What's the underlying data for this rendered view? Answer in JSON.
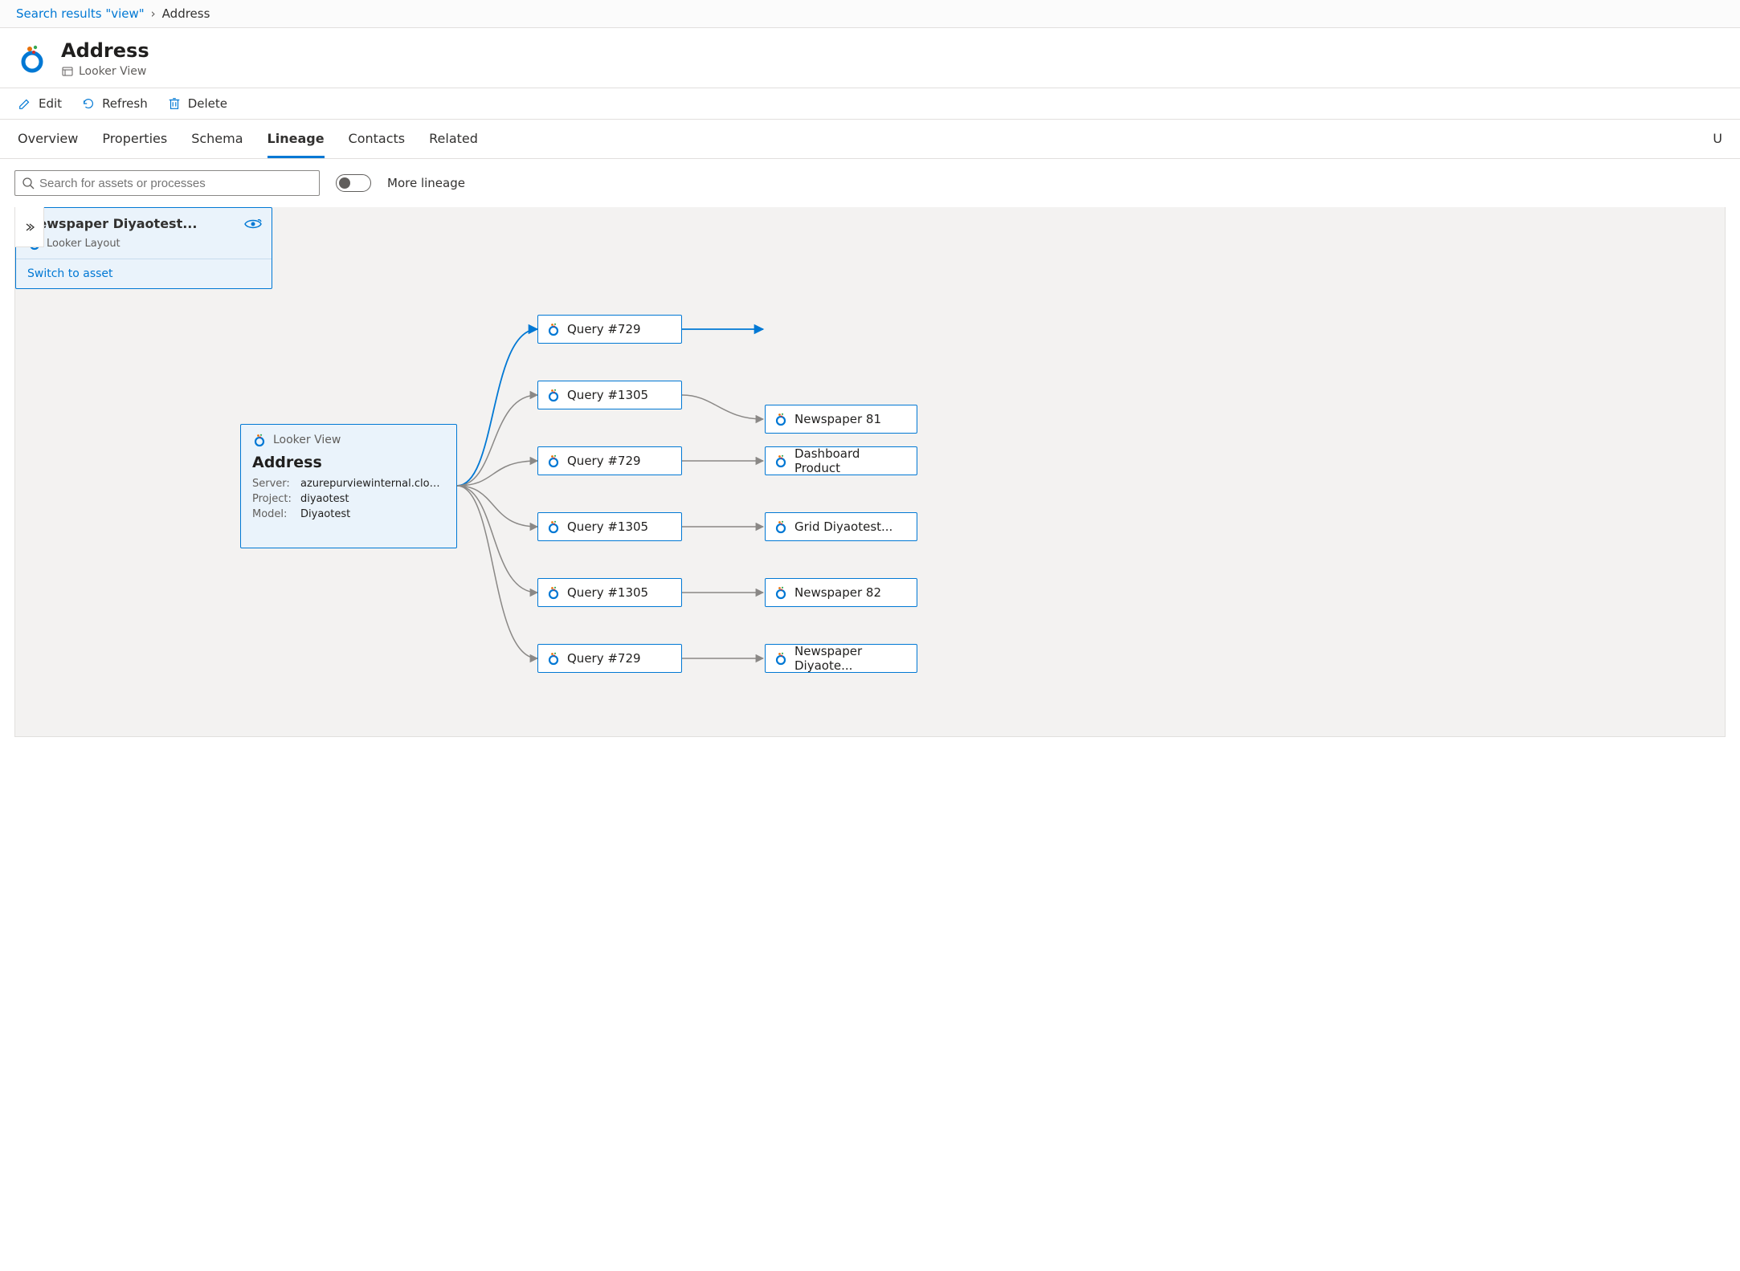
{
  "breadcrumb": {
    "link": "Search results \"view\"",
    "current": "Address"
  },
  "header": {
    "title": "Address",
    "subtype": "Looker View"
  },
  "toolbar": {
    "edit": "Edit",
    "refresh": "Refresh",
    "delete": "Delete"
  },
  "tabs": {
    "overview": "Overview",
    "properties": "Properties",
    "schema": "Schema",
    "lineage": "Lineage",
    "contacts": "Contacts",
    "related": "Related",
    "right": "U"
  },
  "controls": {
    "search_placeholder": "Search for assets or processes",
    "more_lineage": "More lineage"
  },
  "source": {
    "type_label": "Looker View",
    "name": "Address",
    "server_label": "Server:",
    "server_value": "azurepurviewinternal.cloud.looker.co",
    "project_label": "Project:",
    "project_value": "diyaotest",
    "model_label": "Model:",
    "model_value": "Diyaotest"
  },
  "queries": {
    "q0": "Query #729",
    "q1": "Query #1305",
    "q2": "Query #729",
    "q3": "Query #1305",
    "q4": "Query #1305",
    "q5": "Query #729"
  },
  "expanded": {
    "title": "Newspaper Diyaotest...",
    "subtype": "Looker Layout",
    "switch": "Switch to asset"
  },
  "dests": {
    "d1": "Newspaper 81",
    "d2": "Dashboard Product",
    "d3": "Grid Diyaotest...",
    "d4": "Newspaper 82",
    "d5": "Newspaper Diyaote..."
  }
}
